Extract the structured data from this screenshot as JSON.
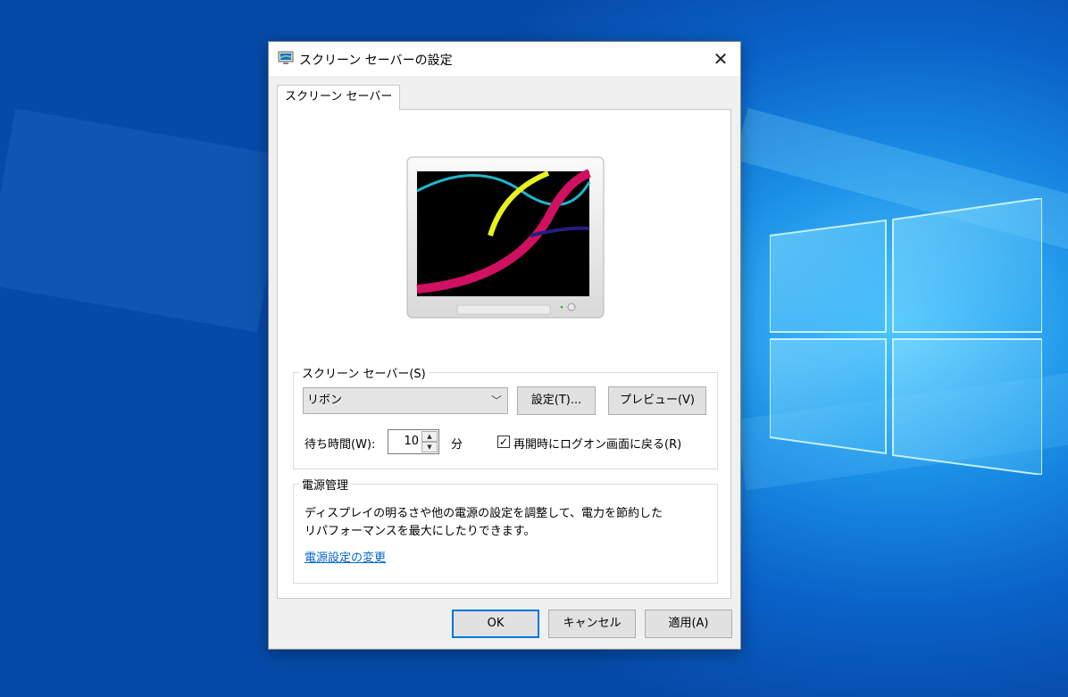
{
  "dialog": {
    "title": "スクリーン セーバーの設定",
    "close_glyph": "✕",
    "tab_label": "スクリーン セーバー"
  },
  "screensaver": {
    "group_label": "スクリーン セーバー(S)",
    "selected": "リボン",
    "settings_button": "設定(T)...",
    "preview_button": "プレビュー(V)",
    "wait_label": "待ち時間(W):",
    "wait_value": "10",
    "wait_unit": "分",
    "logon_checkbox_label": "再開時にログオン画面に戻る(R)",
    "logon_checked": true
  },
  "power": {
    "group_label": "電源管理",
    "description_line1": "ディスプレイの明るさや他の電源の設定を調整して、電力を節約した",
    "description_line2": "リパフォーマンスを最大にしたりできます。",
    "link": "電源設定の変更"
  },
  "buttons": {
    "ok": "OK",
    "cancel": "キャンセル",
    "apply": "適用(A)"
  },
  "colors": {
    "accent": "#0078d7",
    "desktop": "#0a62c8",
    "link": "#0066cc"
  },
  "icons": {
    "title_icon": "screensaver-monitor-icon",
    "close": "close-icon",
    "combo_arrow": "chevron-down-icon"
  }
}
